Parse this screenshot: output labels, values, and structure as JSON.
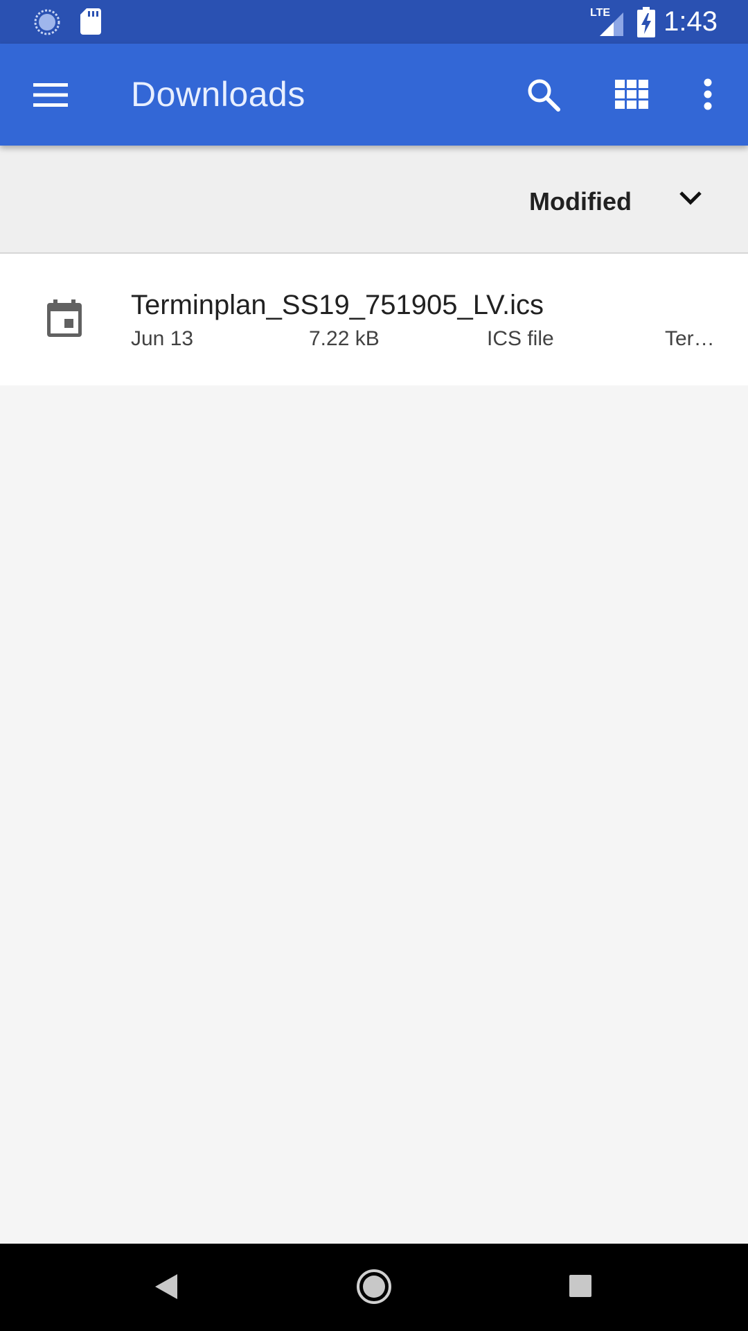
{
  "status_bar": {
    "time": "1:43",
    "network_label": "LTE",
    "icons": [
      "sync-icon",
      "sd-card-icon",
      "lte-signal-icon",
      "battery-charging-icon"
    ]
  },
  "app_bar": {
    "title": "Downloads",
    "icons": [
      "menu-icon",
      "search-icon",
      "grid-view-icon",
      "more-vert-icon"
    ],
    "color": "#3367d6"
  },
  "sort": {
    "label": "Modified",
    "icon": "chevron-down-icon"
  },
  "files": [
    {
      "name": "Terminplan_SS19_751905_LV.ics",
      "date": "Jun 13",
      "size": "7.22 kB",
      "type": "ICS file",
      "summary": "Ter…",
      "icon": "calendar-icon"
    }
  ],
  "nav_bar": {
    "icons": [
      "back-icon",
      "home-icon",
      "recents-icon"
    ]
  }
}
